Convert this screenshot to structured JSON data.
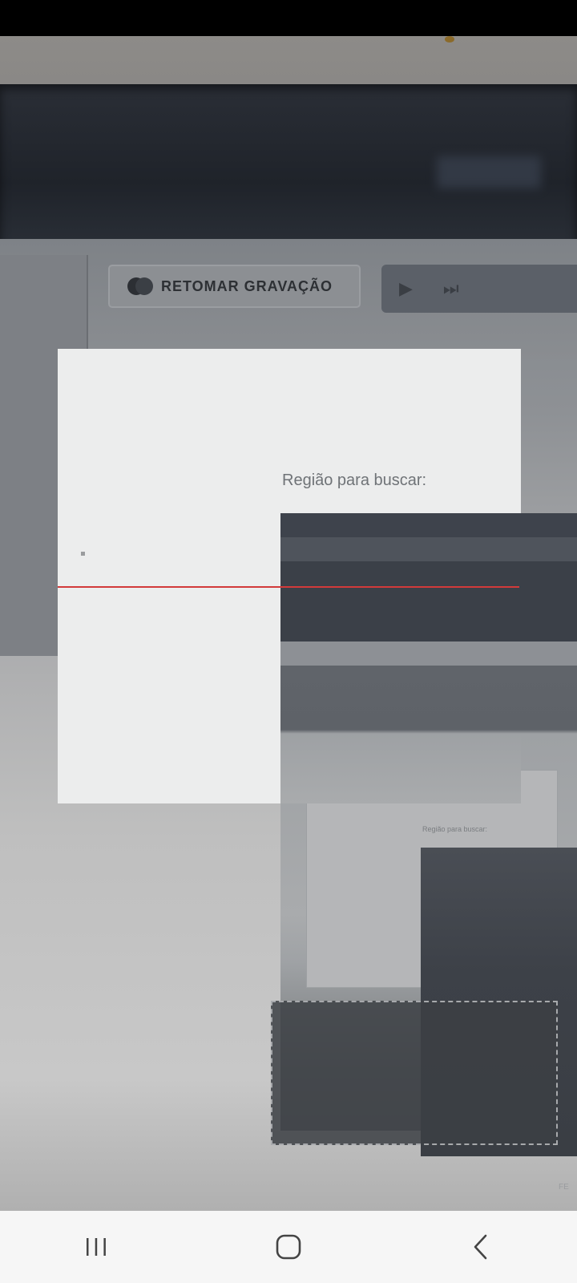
{
  "toolbar": {
    "resume_recording_label": "RETOMAR GRAVAÇÃO",
    "record_toggle_icon": "record-toggle-icon",
    "playback_icons": [
      "play-icon",
      "skip-next-icon"
    ]
  },
  "search_overlay": {
    "region_label": "Região para buscar:",
    "preview_label": "Região para buscar:",
    "capture_line_color": "#d23a3a"
  },
  "footer_text": "FE",
  "navigation_bar": {
    "buttons": [
      "recent-apps-icon",
      "home-icon",
      "back-icon"
    ]
  }
}
